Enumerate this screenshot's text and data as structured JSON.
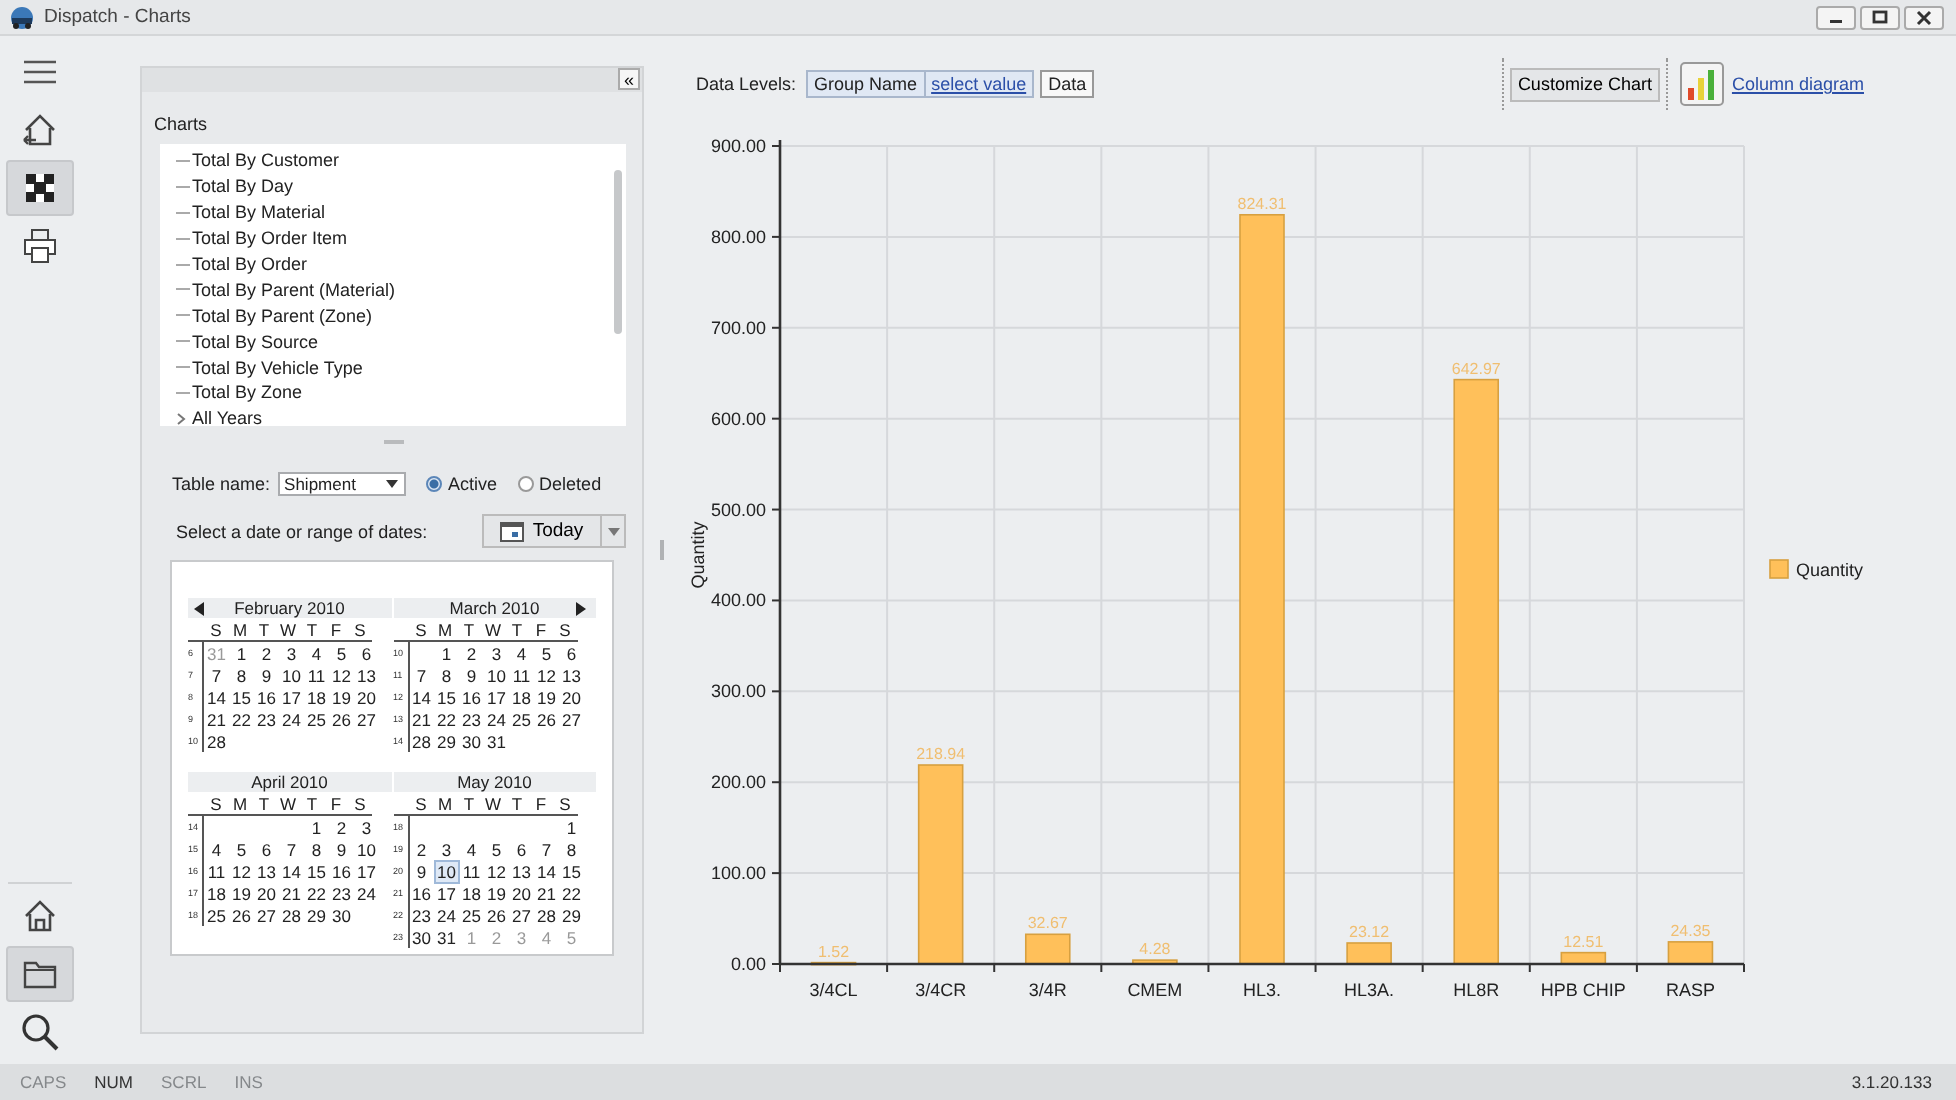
{
  "window": {
    "title": "Dispatch - Charts"
  },
  "rail_top": [
    {
      "kind": "menu",
      "selected": false
    },
    {
      "kind": "home-back",
      "selected": false
    },
    {
      "kind": "grid",
      "selected": true
    },
    {
      "kind": "print",
      "selected": false
    }
  ],
  "rail_bottom": [
    {
      "kind": "home",
      "selected": false
    },
    {
      "kind": "folder",
      "selected": true
    },
    {
      "kind": "search",
      "selected": false
    }
  ],
  "panel": {
    "collapse": "«",
    "title": "Charts",
    "tree": [
      {
        "label": "Total By Customer",
        "kind": "leaf"
      },
      {
        "label": "Total By Day",
        "kind": "leaf"
      },
      {
        "label": "Total By Material",
        "kind": "leaf"
      },
      {
        "label": "Total By Order Item",
        "kind": "leaf"
      },
      {
        "label": "Total By Order",
        "kind": "leaf"
      },
      {
        "label": "Total By Parent (Material)",
        "kind": "leaf"
      },
      {
        "label": "Total By Parent (Zone)",
        "kind": "leaf"
      },
      {
        "label": "Total By Source",
        "kind": "leaf"
      },
      {
        "label": "Total By Vehicle Type",
        "kind": "leaf"
      },
      {
        "label": "Total By Zone",
        "kind": "leaf"
      },
      {
        "label": "All Years",
        "kind": "group"
      }
    ],
    "table_label": "Table name:",
    "table_value": "Shipment",
    "radios": [
      {
        "label": "Active",
        "selected": true
      },
      {
        "label": "Deleted",
        "selected": false
      }
    ],
    "date_label": "Select a date or range of dates:",
    "today": "Today",
    "calendar": [
      {
        "title": "February 2010",
        "kind": "prev",
        "weekdays": [
          "S",
          "M",
          "T",
          "W",
          "T",
          "F",
          "S"
        ],
        "weeks": [
          {
            "number": "6",
            "kind": "full",
            "days": [
              {
                "d": "31",
                "other": true,
                "selected": false
              },
              {
                "d": "1",
                "other": false,
                "selected": false
              },
              {
                "d": "2",
                "other": false,
                "selected": false
              },
              {
                "d": "3",
                "other": false,
                "selected": false
              },
              {
                "d": "4",
                "other": false,
                "selected": false
              },
              {
                "d": "5",
                "other": false,
                "selected": false
              },
              {
                "d": "6",
                "other": false,
                "selected": false
              }
            ]
          },
          {
            "number": "7",
            "kind": "full",
            "days": [
              {
                "d": "7",
                "other": false,
                "selected": false
              },
              {
                "d": "8",
                "other": false,
                "selected": false
              },
              {
                "d": "9",
                "other": false,
                "selected": false
              },
              {
                "d": "10",
                "other": false,
                "selected": false
              },
              {
                "d": "11",
                "other": false,
                "selected": false
              },
              {
                "d": "12",
                "other": false,
                "selected": false
              },
              {
                "d": "13",
                "other": false,
                "selected": false
              }
            ]
          },
          {
            "number": "8",
            "kind": "full",
            "days": [
              {
                "d": "14",
                "other": false,
                "selected": false
              },
              {
                "d": "15",
                "other": false,
                "selected": false
              },
              {
                "d": "16",
                "other": false,
                "selected": false
              },
              {
                "d": "17",
                "other": false,
                "selected": false
              },
              {
                "d": "18",
                "other": false,
                "selected": false
              },
              {
                "d": "19",
                "other": false,
                "selected": false
              },
              {
                "d": "20",
                "other": false,
                "selected": false
              }
            ]
          },
          {
            "number": "9",
            "kind": "full",
            "days": [
              {
                "d": "21",
                "other": false,
                "selected": false
              },
              {
                "d": "22",
                "other": false,
                "selected": false
              },
              {
                "d": "23",
                "other": false,
                "selected": false
              },
              {
                "d": "24",
                "other": false,
                "selected": false
              },
              {
                "d": "25",
                "other": false,
                "selected": false
              },
              {
                "d": "26",
                "other": false,
                "selected": false
              },
              {
                "d": "27",
                "other": false,
                "selected": false
              }
            ]
          },
          {
            "number": "10",
            "kind": "leading",
            "days": [
              {
                "d": "28",
                "other": false,
                "selected": false
              }
            ]
          }
        ]
      },
      {
        "title": "March 2010",
        "kind": "next",
        "weekdays": [
          "S",
          "M",
          "T",
          "W",
          "T",
          "F",
          "S"
        ],
        "weeks": [
          {
            "number": "10",
            "kind": "trailing",
            "days": [
              {
                "d": "1",
                "other": false,
                "selected": false
              },
              {
                "d": "2",
                "other": false,
                "selected": false
              },
              {
                "d": "3",
                "other": false,
                "selected": false
              },
              {
                "d": "4",
                "other": false,
                "selected": false
              },
              {
                "d": "5",
                "other": false,
                "selected": false
              },
              {
                "d": "6",
                "other": false,
                "selected": false
              }
            ]
          },
          {
            "number": "11",
            "kind": "full",
            "days": [
              {
                "d": "7",
                "other": false,
                "selected": false
              },
              {
                "d": "8",
                "other": false,
                "selected": false
              },
              {
                "d": "9",
                "other": false,
                "selected": false
              },
              {
                "d": "10",
                "other": false,
                "selected": false
              },
              {
                "d": "11",
                "other": false,
                "selected": false
              },
              {
                "d": "12",
                "other": false,
                "selected": false
              },
              {
                "d": "13",
                "other": false,
                "selected": false
              }
            ]
          },
          {
            "number": "12",
            "kind": "full",
            "days": [
              {
                "d": "14",
                "other": false,
                "selected": false
              },
              {
                "d": "15",
                "other": false,
                "selected": false
              },
              {
                "d": "16",
                "other": false,
                "selected": false
              },
              {
                "d": "17",
                "other": false,
                "selected": false
              },
              {
                "d": "18",
                "other": false,
                "selected": false
              },
              {
                "d": "19",
                "other": false,
                "selected": false
              },
              {
                "d": "20",
                "other": false,
                "selected": false
              }
            ]
          },
          {
            "number": "13",
            "kind": "full",
            "days": [
              {
                "d": "21",
                "other": false,
                "selected": false
              },
              {
                "d": "22",
                "other": false,
                "selected": false
              },
              {
                "d": "23",
                "other": false,
                "selected": false
              },
              {
                "d": "24",
                "other": false,
                "selected": false
              },
              {
                "d": "25",
                "other": false,
                "selected": false
              },
              {
                "d": "26",
                "other": false,
                "selected": false
              },
              {
                "d": "27",
                "other": false,
                "selected": false
              }
            ]
          },
          {
            "number": "14",
            "kind": "leading",
            "days": [
              {
                "d": "28",
                "other": false,
                "selected": false
              },
              {
                "d": "29",
                "other": false,
                "selected": false
              },
              {
                "d": "30",
                "other": false,
                "selected": false
              },
              {
                "d": "31",
                "other": false,
                "selected": false
              }
            ]
          }
        ]
      },
      {
        "title": "April 2010",
        "kind": "plain",
        "weekdays": [
          "S",
          "M",
          "T",
          "W",
          "T",
          "F",
          "S"
        ],
        "weeks": [
          {
            "number": "14",
            "kind": "trailing",
            "days": [
              {
                "d": "1",
                "other": false,
                "selected": false
              },
              {
                "d": "2",
                "other": false,
                "selected": false
              },
              {
                "d": "3",
                "other": false,
                "selected": false
              }
            ]
          },
          {
            "number": "15",
            "kind": "full",
            "days": [
              {
                "d": "4",
                "other": false,
                "selected": false
              },
              {
                "d": "5",
                "other": false,
                "selected": false
              },
              {
                "d": "6",
                "other": false,
                "selected": false
              },
              {
                "d": "7",
                "other": false,
                "selected": false
              },
              {
                "d": "8",
                "other": false,
                "selected": false
              },
              {
                "d": "9",
                "other": false,
                "selected": false
              },
              {
                "d": "10",
                "other": false,
                "selected": false
              }
            ]
          },
          {
            "number": "16",
            "kind": "full",
            "days": [
              {
                "d": "11",
                "other": false,
                "selected": false
              },
              {
                "d": "12",
                "other": false,
                "selected": false
              },
              {
                "d": "13",
                "other": false,
                "selected": false
              },
              {
                "d": "14",
                "other": false,
                "selected": false
              },
              {
                "d": "15",
                "other": false,
                "selected": false
              },
              {
                "d": "16",
                "other": false,
                "selected": false
              },
              {
                "d": "17",
                "other": false,
                "selected": false
              }
            ]
          },
          {
            "number": "17",
            "kind": "full",
            "days": [
              {
                "d": "18",
                "other": false,
                "selected": false
              },
              {
                "d": "19",
                "other": false,
                "selected": false
              },
              {
                "d": "20",
                "other": false,
                "selected": false
              },
              {
                "d": "21",
                "other": false,
                "selected": false
              },
              {
                "d": "22",
                "other": false,
                "selected": false
              },
              {
                "d": "23",
                "other": false,
                "selected": false
              },
              {
                "d": "24",
                "other": false,
                "selected": false
              }
            ]
          },
          {
            "number": "18",
            "kind": "leading",
            "days": [
              {
                "d": "25",
                "other": false,
                "selected": false
              },
              {
                "d": "26",
                "other": false,
                "selected": false
              },
              {
                "d": "27",
                "other": false,
                "selected": false
              },
              {
                "d": "28",
                "other": false,
                "selected": false
              },
              {
                "d": "29",
                "other": false,
                "selected": false
              },
              {
                "d": "30",
                "other": false,
                "selected": false
              }
            ]
          }
        ]
      },
      {
        "title": "May 2010",
        "kind": "plain",
        "weekdays": [
          "S",
          "M",
          "T",
          "W",
          "T",
          "F",
          "S"
        ],
        "weeks": [
          {
            "number": "18",
            "kind": "trailing",
            "days": [
              {
                "d": "1",
                "other": false,
                "selected": false
              }
            ]
          },
          {
            "number": "19",
            "kind": "full",
            "days": [
              {
                "d": "2",
                "other": false,
                "selected": false
              },
              {
                "d": "3",
                "other": false,
                "selected": false
              },
              {
                "d": "4",
                "other": false,
                "selected": false
              },
              {
                "d": "5",
                "other": false,
                "selected": false
              },
              {
                "d": "6",
                "other": false,
                "selected": false
              },
              {
                "d": "7",
                "other": false,
                "selected": false
              },
              {
                "d": "8",
                "other": false,
                "selected": false
              }
            ]
          },
          {
            "number": "20",
            "kind": "full",
            "days": [
              {
                "d": "9",
                "other": false,
                "selected": false
              },
              {
                "d": "10",
                "other": false,
                "selected": true
              },
              {
                "d": "11",
                "other": false,
                "selected": false
              },
              {
                "d": "12",
                "other": false,
                "selected": false
              },
              {
                "d": "13",
                "other": false,
                "selected": false
              },
              {
                "d": "14",
                "other": false,
                "selected": false
              },
              {
                "d": "15",
                "other": false,
                "selected": false
              }
            ]
          },
          {
            "number": "21",
            "kind": "full",
            "days": [
              {
                "d": "16",
                "other": false,
                "selected": false
              },
              {
                "d": "17",
                "other": false,
                "selected": false
              },
              {
                "d": "18",
                "other": false,
                "selected": false
              },
              {
                "d": "19",
                "other": false,
                "selected": false
              },
              {
                "d": "20",
                "other": false,
                "selected": false
              },
              {
                "d": "21",
                "other": false,
                "selected": false
              },
              {
                "d": "22",
                "other": false,
                "selected": false
              }
            ]
          },
          {
            "number": "22",
            "kind": "full",
            "days": [
              {
                "d": "23",
                "other": false,
                "selected": false
              },
              {
                "d": "24",
                "other": false,
                "selected": false
              },
              {
                "d": "25",
                "other": false,
                "selected": false
              },
              {
                "d": "26",
                "other": false,
                "selected": false
              },
              {
                "d": "27",
                "other": false,
                "selected": false
              },
              {
                "d": "28",
                "other": false,
                "selected": false
              },
              {
                "d": "29",
                "other": false,
                "selected": false
              }
            ]
          },
          {
            "number": "23",
            "kind": "full",
            "days": [
              {
                "d": "30",
                "other": false,
                "selected": false
              },
              {
                "d": "31",
                "other": false,
                "selected": false
              },
              {
                "d": "1",
                "other": true,
                "selected": false
              },
              {
                "d": "2",
                "other": true,
                "selected": false
              },
              {
                "d": "3",
                "other": true,
                "selected": false
              },
              {
                "d": "4",
                "other": true,
                "selected": false
              },
              {
                "d": "5",
                "other": true,
                "selected": false
              }
            ]
          }
        ]
      }
    ]
  },
  "toolbar": {
    "data_levels_label": "Data Levels:",
    "levels": [
      {
        "label": "Group Name",
        "kind": "chip"
      },
      {
        "label": "select value",
        "kind": "link"
      },
      {
        "label": "Data",
        "kind": "box"
      }
    ],
    "customize": "Customize Chart",
    "diagram_link": "Column diagram"
  },
  "chart": {
    "chart_data": {
      "type": "bar",
      "ylabel": "Quantity",
      "categories": [
        "3/4CL",
        "3/4CR",
        "3/4R",
        "CMEM",
        "HL3.",
        "HL3A.",
        "HL8R",
        "HPB CHIP",
        "RASP"
      ],
      "series": [
        {
          "name": "Quantity",
          "color": "#ffc05a",
          "values": [
            1.52,
            218.94,
            32.67,
            4.28,
            824.31,
            23.12,
            642.97,
            12.51,
            24.35
          ]
        }
      ],
      "ylim": [
        0,
        900
      ],
      "yticks": [
        {
          "value": 0,
          "label": "0.00"
        },
        {
          "value": 100,
          "label": "100.00"
        },
        {
          "value": 200,
          "label": "200.00"
        },
        {
          "value": 300,
          "label": "300.00"
        },
        {
          "value": 400,
          "label": "400.00"
        },
        {
          "value": 500,
          "label": "500.00"
        },
        {
          "value": 600,
          "label": "600.00"
        },
        {
          "value": 700,
          "label": "700.00"
        },
        {
          "value": 800,
          "label": "800.00"
        },
        {
          "value": 900,
          "label": "900.00"
        }
      ],
      "grid": true,
      "data_labels": true,
      "value_labels": [
        "1.52",
        "218.94",
        "32.67",
        "4.28",
        "824.31",
        "23.12",
        "642.97",
        "12.51",
        "24.35"
      ]
    }
  },
  "status_bar": {
    "keys": [
      {
        "label": "CAPS",
        "on": false
      },
      {
        "label": "NUM",
        "on": true
      },
      {
        "label": "SCRL",
        "on": false
      },
      {
        "label": "INS",
        "on": false
      }
    ],
    "version": "3.1.20.133"
  }
}
